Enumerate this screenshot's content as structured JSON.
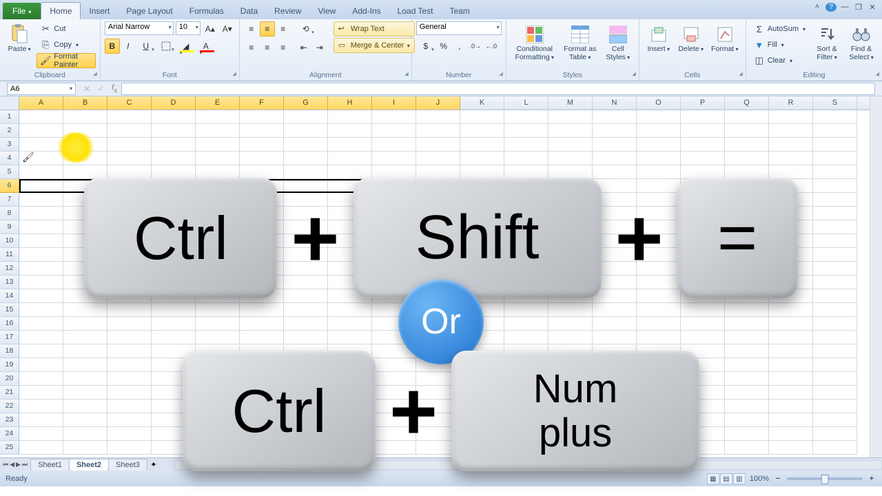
{
  "tabs": {
    "file": "File",
    "home": "Home",
    "insert": "Insert",
    "pagelayout": "Page Layout",
    "formulas": "Formulas",
    "data": "Data",
    "review": "Review",
    "view": "View",
    "addins": "Add-Ins",
    "loadtest": "Load Test",
    "team": "Team"
  },
  "clipboard": {
    "paste": "Paste",
    "cut": "Cut",
    "copy": "Copy",
    "painter": "Format Painter",
    "label": "Clipboard"
  },
  "font": {
    "name": "Arial Narrow",
    "size": "10",
    "label": "Font"
  },
  "alignment": {
    "wrap": "Wrap Text",
    "merge": "Merge & Center",
    "label": "Alignment"
  },
  "number": {
    "format": "General",
    "label": "Number"
  },
  "styles": {
    "cond": "Conditional Formatting",
    "table": "Format as Table",
    "cell": "Cell Styles",
    "label": "Styles"
  },
  "cells": {
    "insert": "Insert",
    "delete": "Delete",
    "format": "Format",
    "label": "Cells"
  },
  "editing": {
    "autosum": "AutoSum",
    "fill": "Fill",
    "clear": "Clear",
    "sort": "Sort & Filter",
    "find": "Find & Select",
    "label": "Editing"
  },
  "namebox": "A6",
  "columns": [
    "A",
    "B",
    "C",
    "D",
    "E",
    "F",
    "G",
    "H",
    "I",
    "J",
    "K",
    "L",
    "M",
    "N",
    "O",
    "P",
    "Q",
    "R",
    "S"
  ],
  "selected_cols": [
    "A",
    "B",
    "C",
    "D",
    "E",
    "F",
    "G",
    "H",
    "I",
    "J"
  ],
  "selected_row": 6,
  "row_count": 25,
  "sheets": {
    "s1": "Sheet1",
    "s2": "Sheet2",
    "s3": "Sheet3"
  },
  "status": "Ready",
  "zoom": "100%",
  "overlay": {
    "ctrl": "Ctrl",
    "shift": "Shift",
    "equals": "=",
    "plus": "+",
    "or": "Or",
    "num1": "Num",
    "num2": "plus"
  }
}
